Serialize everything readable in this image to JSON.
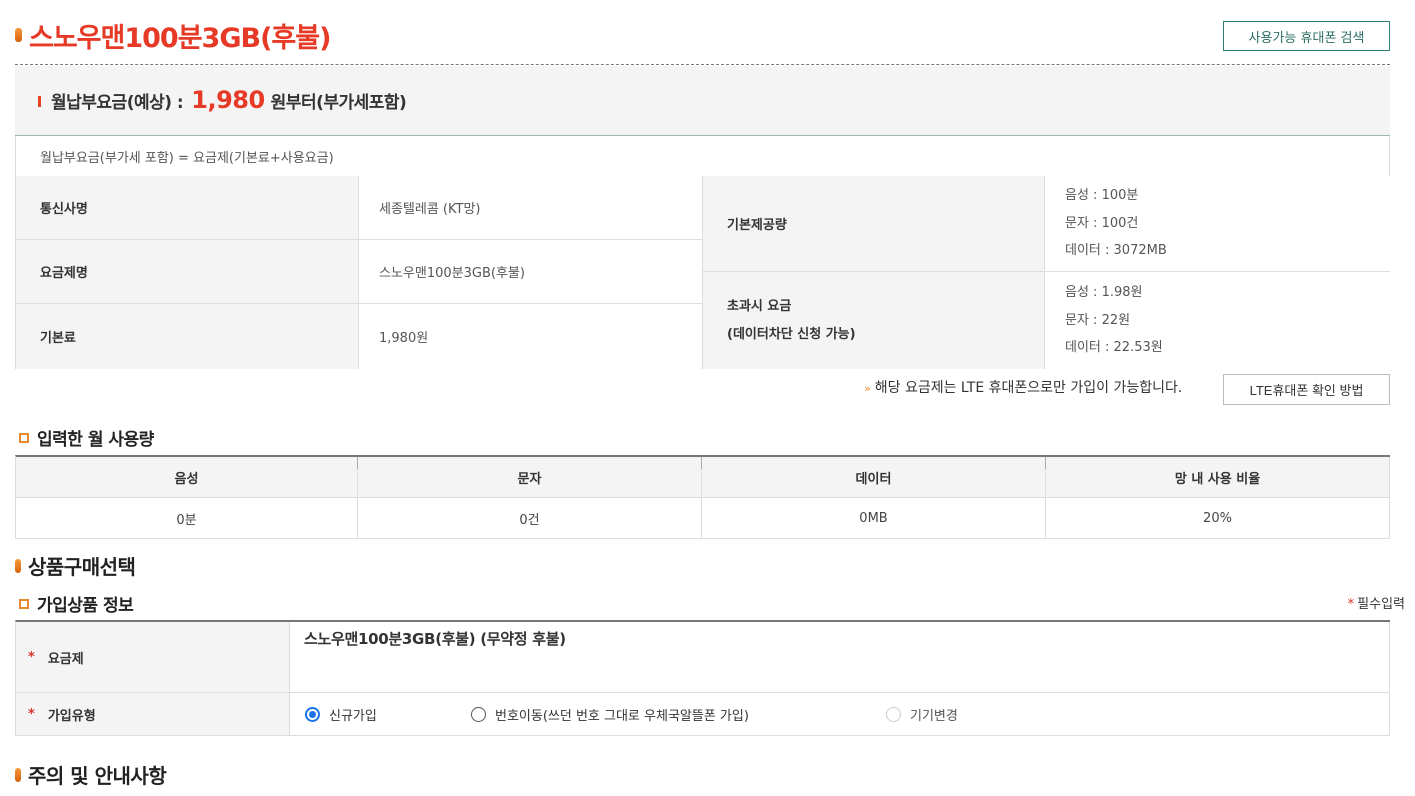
{
  "header": {
    "title": "스노우맨100분3GB(후불)",
    "search_button": "사용가능 휴대폰 검색"
  },
  "monthly_fee": {
    "label": "월납부요금(예상) :",
    "amount": "1,980",
    "suffix": "원부터(부가세포함)",
    "formula": "월납부요금(부가세 포함) = 요금제(기본료+사용요금)"
  },
  "info": {
    "carrier_label": "통신사명",
    "carrier_value": "세종텔레콤 (KT망)",
    "plan_label": "요금제명",
    "plan_value": "스노우맨100분3GB(후불)",
    "base_fee_label": "기본료",
    "base_fee_value": "1,980원",
    "provided_label": "기본제공량",
    "provided_voice": "음성 : 100분",
    "provided_sms": "문자 : 100건",
    "provided_data": "데이터 : 3072MB",
    "overage_label_1": "초과시 요금",
    "overage_label_2": "(데이터차단 신청 가능)",
    "overage_voice": "음성 : 1.98원",
    "overage_sms": "문자 : 22원",
    "overage_data": "데이터 : 22.53원"
  },
  "lte_note": {
    "text": "해당 요금제는 LTE 휴대폰으로만 가입이 가능합니다.",
    "button": "LTE휴대폰 확인 방법"
  },
  "usage": {
    "heading": "입력한 월 사용량",
    "headers": [
      "음성",
      "문자",
      "데이터",
      "망 내 사용 비율"
    ],
    "values": [
      "0분",
      "0건",
      "0MB",
      "20%"
    ]
  },
  "purchase": {
    "heading": "상품구매선택",
    "sub_heading": "가입상품 정보",
    "required_note": "필수입력",
    "plan_label": "요금제",
    "plan_value": "스노우맨100분3GB(후불) (무약정 후불)",
    "join_type_label": "가입유형",
    "options": [
      "신규가입",
      "번호이동(쓰던 번호 그대로 우체국알뜰폰 가입)",
      "기기변경"
    ],
    "selected": "신규가입"
  },
  "notice": {
    "heading": "주의 및 안내사항"
  },
  "colors": {
    "accent_red": "#e63a26",
    "accent_orange": "#e8882c",
    "button_green": "#2e7d72",
    "radio_blue": "#1a73e8"
  }
}
